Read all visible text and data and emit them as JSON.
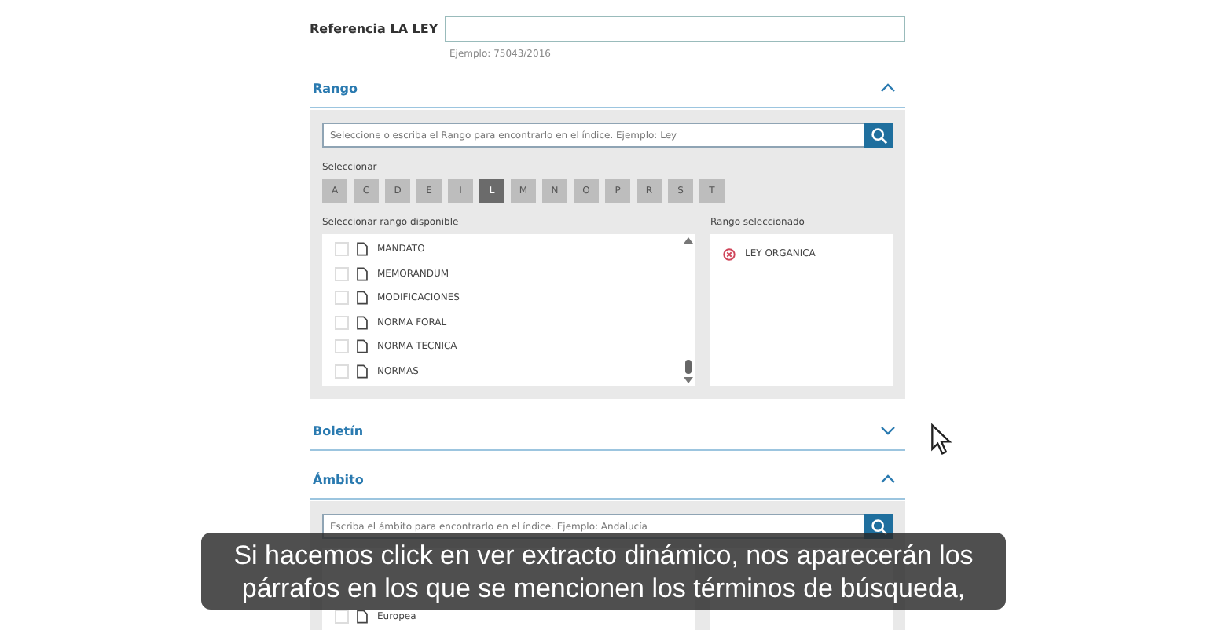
{
  "reference": {
    "label": "Referencia LA LEY",
    "hint": "Ejemplo: 75043/2016"
  },
  "rango": {
    "title": "Rango",
    "expanded": true,
    "search_placeholder": "Seleccione o escriba el Rango para encontrarlo en el índice. Ejemplo: Ley",
    "letters_label": "Seleccionar",
    "letters": [
      {
        "label": "A",
        "selected": false
      },
      {
        "label": "C",
        "selected": false
      },
      {
        "label": "D",
        "selected": false
      },
      {
        "label": "E",
        "selected": false
      },
      {
        "label": "I",
        "selected": false
      },
      {
        "label": "L",
        "selected": true
      },
      {
        "label": "M",
        "selected": false
      },
      {
        "label": "N",
        "selected": false
      },
      {
        "label": "O",
        "selected": false
      },
      {
        "label": "P",
        "selected": false
      },
      {
        "label": "R",
        "selected": false
      },
      {
        "label": "S",
        "selected": false
      },
      {
        "label": "T",
        "selected": false
      }
    ],
    "available_label": "Seleccionar rango disponible",
    "available": [
      {
        "label": "MANDATO",
        "checked": false
      },
      {
        "label": "MEMORANDUM",
        "checked": false
      },
      {
        "label": "MODIFICACIONES",
        "checked": false
      },
      {
        "label": "NORMA FORAL",
        "checked": false
      },
      {
        "label": "NORMA TECNICA",
        "checked": false
      },
      {
        "label": "NORMAS",
        "checked": false
      }
    ],
    "selected_label": "Rango seleccionado",
    "selected_items": [
      "LEY ORGANICA"
    ]
  },
  "boletin": {
    "title": "Boletín",
    "expanded": false
  },
  "ambito": {
    "title": "Ámbito",
    "expanded": true,
    "search_placeholder": "Escriba el ámbito para encontrarlo en el índice. Ejemplo: Andalucía",
    "available": [
      {
        "label": "Europea",
        "checked": false
      }
    ]
  },
  "subtitle": [
    "Si hacemos click en ver extracto dinámico, nos aparecerán los",
    "párrafos en los que se mencionen los términos de búsqueda,"
  ]
}
